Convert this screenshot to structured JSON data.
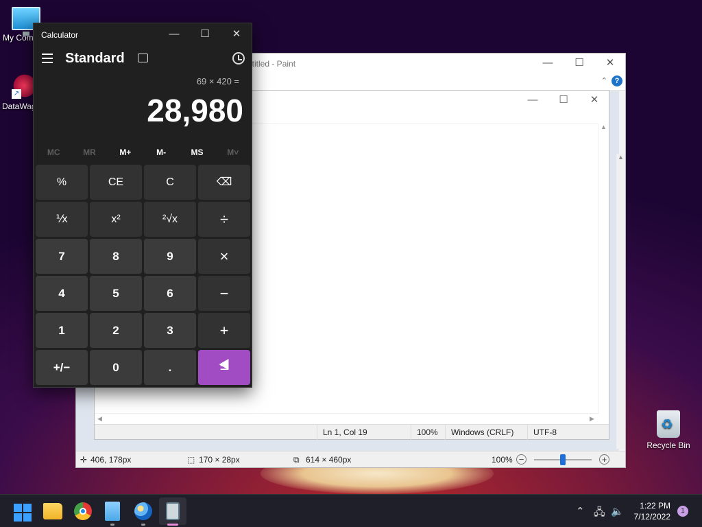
{
  "desktop": {
    "icons": [
      {
        "label": "My Com",
        "icon": "computer-icon"
      },
      {
        "label": "DataWag",
        "icon": "datawag-icon"
      },
      {
        "label": "Recycle Bin",
        "icon": "recycle-bin-icon"
      }
    ]
  },
  "paint": {
    "title": "ntitled - Paint",
    "status": {
      "cursor_pos": "406, 178px",
      "selection_size": "170 × 28px",
      "canvas_size": "614 × 460px",
      "zoom": "100%"
    }
  },
  "notepad": {
    "status": {
      "position": "Ln 1, Col 19",
      "zoom": "100%",
      "line_endings": "Windows (CRLF)",
      "encoding": "UTF-8"
    }
  },
  "calculator": {
    "title": "Calculator",
    "mode": "Standard",
    "expression": "69 × 420 =",
    "result": "28,980",
    "memory": [
      "MC",
      "MR",
      "M+",
      "M-",
      "MS",
      "M˅"
    ],
    "keys": [
      {
        "label": "%",
        "name": "percent-key"
      },
      {
        "label": "CE",
        "name": "clear-entry-key"
      },
      {
        "label": "C",
        "name": "clear-key"
      },
      {
        "label": "⌫",
        "name": "backspace-key"
      },
      {
        "label": "⅟x",
        "name": "reciprocal-key"
      },
      {
        "label": "x²",
        "name": "square-key"
      },
      {
        "label": "²√x",
        "name": "square-root-key"
      },
      {
        "label": "÷",
        "name": "divide-key"
      },
      {
        "label": "7",
        "name": "digit-7-key"
      },
      {
        "label": "8",
        "name": "digit-8-key"
      },
      {
        "label": "9",
        "name": "digit-9-key"
      },
      {
        "label": "×",
        "name": "multiply-key"
      },
      {
        "label": "4",
        "name": "digit-4-key"
      },
      {
        "label": "5",
        "name": "digit-5-key"
      },
      {
        "label": "6",
        "name": "digit-6-key"
      },
      {
        "label": "−",
        "name": "minus-key"
      },
      {
        "label": "1",
        "name": "digit-1-key"
      },
      {
        "label": "2",
        "name": "digit-2-key"
      },
      {
        "label": "3",
        "name": "digit-3-key"
      },
      {
        "label": "+",
        "name": "plus-key"
      },
      {
        "label": "+/−",
        "name": "negate-key"
      },
      {
        "label": "0",
        "name": "digit-0-key"
      },
      {
        "label": ".",
        "name": "decimal-key"
      },
      {
        "label": "=",
        "name": "equals-key"
      }
    ],
    "accent_color": "#a14cc3"
  },
  "taskbar": {
    "time": "1:22 PM",
    "date": "7/12/2022",
    "notification_count": "1"
  }
}
